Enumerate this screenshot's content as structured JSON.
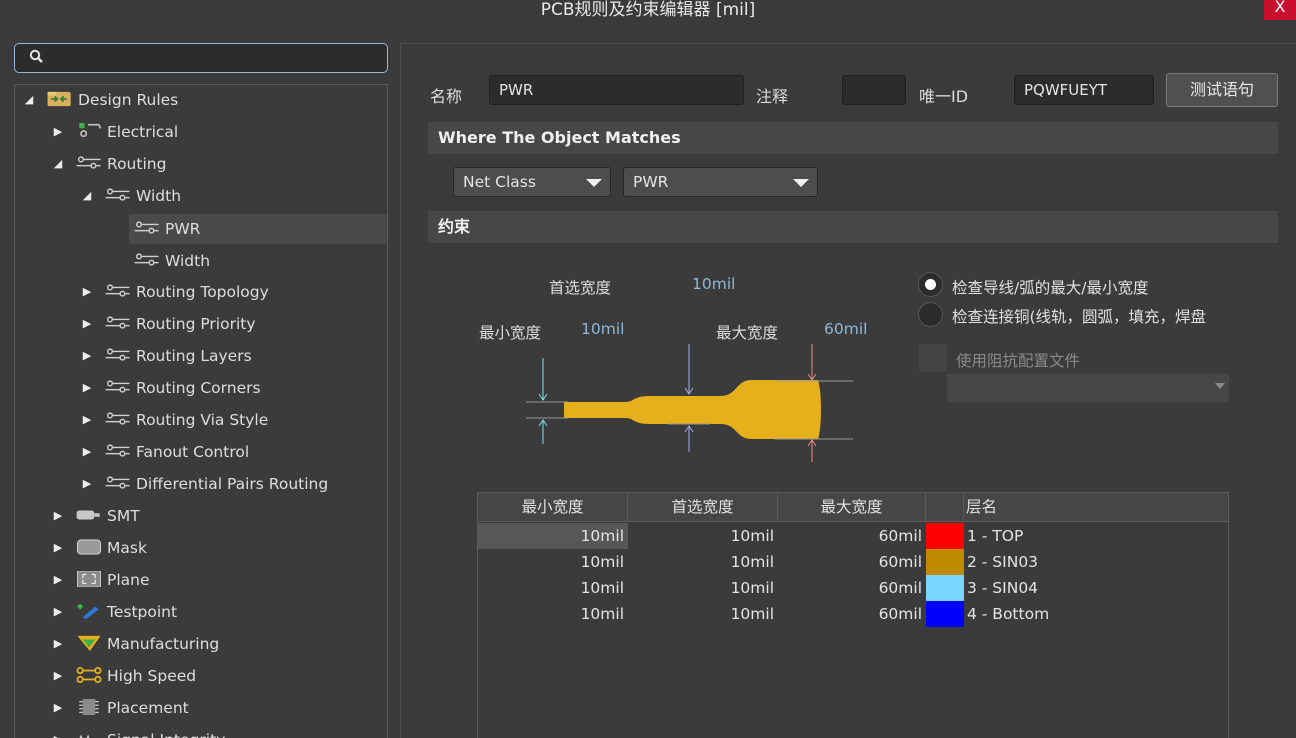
{
  "window": {
    "title": "PCB规则及约束编辑器 [mil]",
    "close_glyph": "X"
  },
  "search": {
    "placeholder": ""
  },
  "tree": [
    {
      "label": "Design Rules",
      "arrow": "◢",
      "icon": "design-rules-folder"
    },
    {
      "label": "Electrical",
      "arrow": "▶",
      "icon": "electrical"
    },
    {
      "label": "Routing",
      "arrow": "◢",
      "icon": "routing"
    },
    {
      "label": "Width",
      "arrow": "◢",
      "icon": "routing"
    },
    {
      "label": "PWR",
      "arrow": "",
      "icon": "routing"
    },
    {
      "label": "Width",
      "arrow": "",
      "icon": "routing"
    },
    {
      "label": "Routing Topology",
      "arrow": "▶",
      "icon": "routing"
    },
    {
      "label": "Routing Priority",
      "arrow": "▶",
      "icon": "routing"
    },
    {
      "label": "Routing Layers",
      "arrow": "▶",
      "icon": "routing"
    },
    {
      "label": "Routing Corners",
      "arrow": "▶",
      "icon": "routing"
    },
    {
      "label": "Routing Via Style",
      "arrow": "▶",
      "icon": "routing"
    },
    {
      "label": "Fanout Control",
      "arrow": "▶",
      "icon": "routing"
    },
    {
      "label": "Differential Pairs Routing",
      "arrow": "▶",
      "icon": "routing"
    },
    {
      "label": "SMT",
      "arrow": "▶",
      "icon": "smt"
    },
    {
      "label": "Mask",
      "arrow": "▶",
      "icon": "mask"
    },
    {
      "label": "Plane",
      "arrow": "▶",
      "icon": "plane"
    },
    {
      "label": "Testpoint",
      "arrow": "▶",
      "icon": "testpoint"
    },
    {
      "label": "Manufacturing",
      "arrow": "▶",
      "icon": "manufacturing"
    },
    {
      "label": "High Speed",
      "arrow": "▶",
      "icon": "high-speed"
    },
    {
      "label": "Placement",
      "arrow": "▶",
      "icon": "placement"
    },
    {
      "label": "Signal Integrity",
      "arrow": "▶",
      "icon": "signal-integrity"
    }
  ],
  "rule": {
    "name_label": "名称",
    "name_value": "PWR",
    "comment_label": "注释",
    "comment_value": "",
    "uid_label": "唯一ID",
    "uid_value": "PQWFUEYT",
    "test_button": "测试语句"
  },
  "match": {
    "header": "Where The Object Matches",
    "type_value": "Net Class",
    "class_value": "PWR"
  },
  "constraints": {
    "header": "约束",
    "preferred_label": "首选宽度",
    "preferred_value": "10mil",
    "min_label": "最小宽度",
    "min_value": "10mil",
    "max_label": "最大宽度",
    "max_value": "60mil",
    "radio1": "检查导线/弧的最大/最小宽度",
    "radio2": "检查连接铜(线轨，圆弧，填充，焊盘",
    "impedance_label": "使用阻抗配置文件"
  },
  "table": {
    "headers": [
      "最小宽度",
      "首选宽度",
      "最大宽度",
      "",
      "层名"
    ],
    "rows": [
      {
        "min": "10mil",
        "pref": "10mil",
        "max": "60mil",
        "color": "#ff0000",
        "layer": "1 - TOP"
      },
      {
        "min": "10mil",
        "pref": "10mil",
        "max": "60mil",
        "color": "#bf8a00",
        "layer": "2 - SIN03"
      },
      {
        "min": "10mil",
        "pref": "10mil",
        "max": "60mil",
        "color": "#7ad6ff",
        "layer": "3 - SIN04"
      },
      {
        "min": "10mil",
        "pref": "10mil",
        "max": "60mil",
        "color": "#0000ff",
        "layer": "4 - Bottom"
      }
    ]
  },
  "colors": {
    "trace": "#e5b01c",
    "accent_value": "#8fb6dc"
  }
}
